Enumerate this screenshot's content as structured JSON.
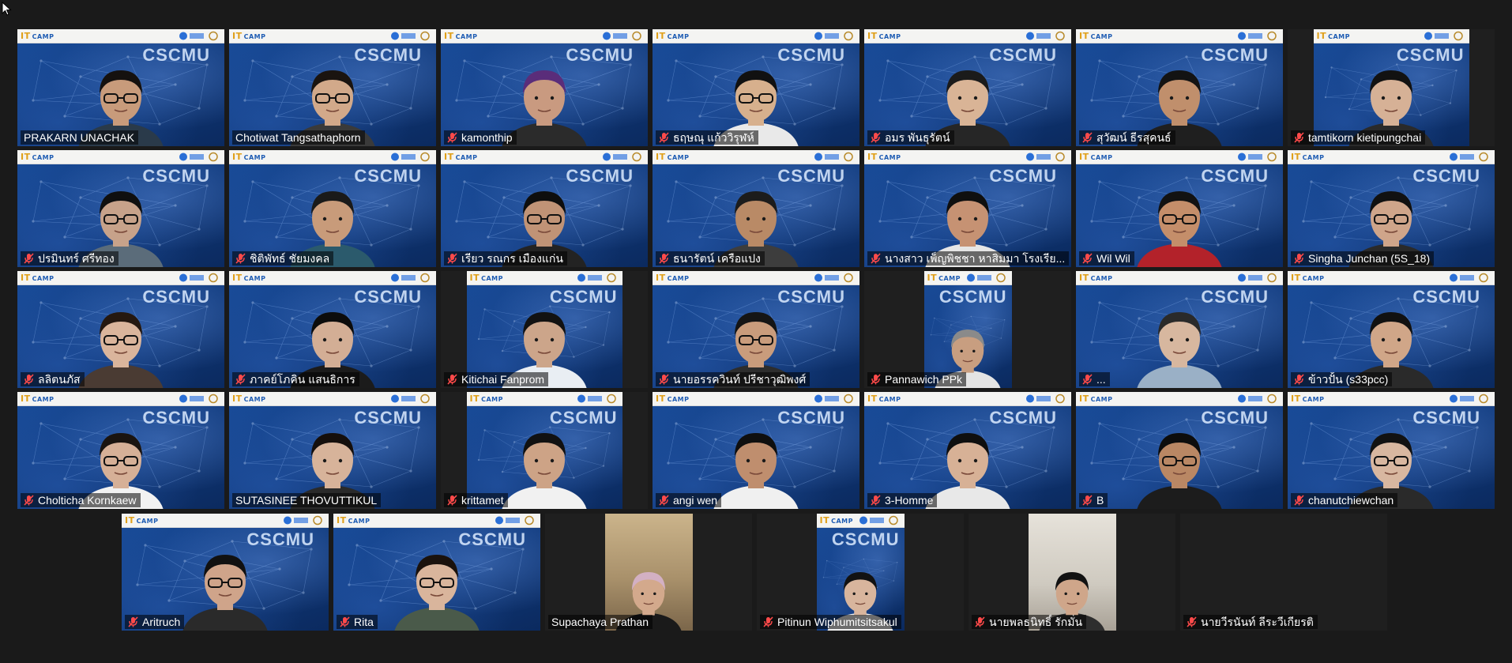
{
  "meeting": {
    "participants": [
      {
        "name": "PRAKARN UNACHAK",
        "muted": false,
        "style": "full",
        "shirt": "#2a3a4a",
        "skin": "#c89b7b",
        "hair": "#15110f",
        "glasses": true
      },
      {
        "name": "Chotiwat Tangsathaphorn",
        "muted": false,
        "style": "full",
        "shirt": "#3a3a3a",
        "skin": "#d2a98a",
        "hair": "#1a1410",
        "glasses": true
      },
      {
        "name": "kamonthip",
        "muted": true,
        "style": "full",
        "shirt": "#2b2b2b",
        "skin": "#c99a80",
        "hair": "#5a2d7a",
        "glasses": false
      },
      {
        "name": "ธฤษณุ แก้ววิรุฬห์",
        "muted": true,
        "style": "full",
        "shirt": "#e9e9e9",
        "skin": "#d7b08d",
        "hair": "#111111",
        "glasses": true
      },
      {
        "name": "อมร พันธุรัตน์",
        "muted": true,
        "style": "full",
        "shirt": "#262626",
        "skin": "#d9b496",
        "hair": "#1b1b1b",
        "glasses": false
      },
      {
        "name": "สุวัฒน์ ธีรสุคนธ์",
        "muted": true,
        "style": "full",
        "shirt": "#1f1f1f",
        "skin": "#c08f6c",
        "hair": "#131313",
        "glasses": false
      },
      {
        "name": "tamtikorn kietipungchai",
        "muted": true,
        "style": "narrow",
        "shirt": "#2a2a2a",
        "skin": "#d6b196",
        "hair": "#121212",
        "glasses": false
      },
      {
        "name": "ปรมินทร์ ศรีทอง",
        "muted": true,
        "style": "full",
        "shirt": "#5b6c7a",
        "skin": "#c7a28a",
        "hair": "#0f0f0f",
        "glasses": true
      },
      {
        "name": "ชิติพัทธ์ ชัยมงคล",
        "muted": true,
        "style": "full",
        "shirt": "#2b5a6c",
        "skin": "#c89b7a",
        "hair": "#1a1a1a",
        "glasses": false
      },
      {
        "name": "เรียว รณกร เมืองแก่น",
        "muted": true,
        "style": "full",
        "shirt": "#232323",
        "skin": "#c09376",
        "hair": "#0e0e0e",
        "glasses": true
      },
      {
        "name": "ธนารัตน์ เครือแปง",
        "muted": true,
        "style": "full",
        "shirt": "#3d3d3d",
        "skin": "#b98a66",
        "hair": "#1c1c1c",
        "glasses": false
      },
      {
        "name": "นางสาว เพ็ญพิชชา หาสิมมา โรงเรีย...",
        "muted": true,
        "style": "full",
        "shirt": "#e6e6e6",
        "skin": "#c69273",
        "hair": "#0f0f0f",
        "glasses": false
      },
      {
        "name": "Wil Wil",
        "muted": true,
        "style": "full",
        "shirt": "#b3222a",
        "skin": "#c48e6a",
        "hair": "#121212",
        "glasses": true
      },
      {
        "name": "Singha Junchan (5S_18)",
        "muted": true,
        "style": "full",
        "shirt": "#2a2a2a",
        "skin": "#cfa58a",
        "hair": "#111111",
        "glasses": true
      },
      {
        "name": "ลลิตนภัส",
        "muted": true,
        "style": "full",
        "shirt": "#4a3b33",
        "skin": "#dab59c",
        "hair": "#251810",
        "glasses": true
      },
      {
        "name": "ภาคย์โภคิน แสนธิการ",
        "muted": true,
        "style": "full",
        "shirt": "#1b1b1b",
        "skin": "#d3ae95",
        "hair": "#0c0c0c",
        "glasses": false
      },
      {
        "name": "Kitichai Fanprom",
        "muted": true,
        "style": "narrow",
        "shirt": "#e9eef3",
        "skin": "#cca58a",
        "hair": "#121212",
        "glasses": false
      },
      {
        "name": "นายอรรควินท์ ปรีชาวุฒิพงศ์",
        "muted": true,
        "style": "full",
        "shirt": "#2d2d2d",
        "skin": "#c99c7c",
        "hair": "#151515",
        "glasses": true
      },
      {
        "name": "Pannawich PPk",
        "muted": true,
        "style": "narrow-small",
        "shirt": "#e4e4e4",
        "skin": "#c89e80",
        "hair": "#8a8a8a",
        "glasses": false
      },
      {
        "name": "...",
        "muted": true,
        "style": "full",
        "shirt": "#9ab0c6",
        "skin": "#d7b79f",
        "hair": "#2a2a2a",
        "glasses": false
      },
      {
        "name": "ข้าวปั้น (s33pcc)",
        "muted": true,
        "style": "full",
        "shirt": "#2a2a2a",
        "skin": "#d0a688",
        "hair": "#111111",
        "glasses": false
      },
      {
        "name": "Cholticha Kornkaew",
        "muted": true,
        "style": "full",
        "shirt": "#f2f2f2",
        "skin": "#d6b097",
        "hair": "#1a1410",
        "glasses": true
      },
      {
        "name": "SUTASINEE THOVUTTIKUL",
        "muted": false,
        "style": "full",
        "shirt": "#2a2a2a",
        "skin": "#d7b39a",
        "hair": "#150f0c",
        "glasses": false
      },
      {
        "name": "krittamet",
        "muted": true,
        "style": "narrow",
        "shirt": "#f1f1f1",
        "skin": "#cda386",
        "hair": "#111111",
        "glasses": false
      },
      {
        "name": "angi wen",
        "muted": true,
        "style": "full",
        "shirt": "#f0f0f0",
        "skin": "#bf8e6e",
        "hair": "#0f0f0f",
        "glasses": false
      },
      {
        "name": "3-Homme",
        "muted": true,
        "style": "full",
        "shirt": "#e8e8e8",
        "skin": "#d7b196",
        "hair": "#0f0f0f",
        "glasses": false
      },
      {
        "name": "B",
        "muted": true,
        "style": "full",
        "shirt": "#1c1c1c",
        "skin": "#b98764",
        "hair": "#0d0d0d",
        "glasses": true
      },
      {
        "name": "chanutchiewchan",
        "muted": true,
        "style": "full",
        "shirt": "#2a2a2a",
        "skin": "#d8b7a0",
        "hair": "#121212",
        "glasses": true
      },
      {
        "name": "Aritruch",
        "muted": true,
        "style": "full",
        "shirt": "#2a2a2a",
        "skin": "#cfa48a",
        "hair": "#111111",
        "glasses": true
      },
      {
        "name": "Rita",
        "muted": true,
        "style": "full",
        "shirt": "#4a5a4a",
        "skin": "#d9b59c",
        "hair": "#1a120d",
        "glasses": true
      },
      {
        "name": "Supachaya Prathan",
        "muted": false,
        "style": "room",
        "shirt": "#1a1a1a",
        "skin": "#d3a98c",
        "hair": "#d3b0c3",
        "glasses": false
      },
      {
        "name": "Pitinun Wiphumitsitsakul",
        "muted": true,
        "style": "narrow-small",
        "shirt": "#f0f0f0",
        "skin": "#d8b59d",
        "hair": "#121212",
        "glasses": false
      },
      {
        "name": "นายพลธนิทธิ์ รักมั่น",
        "muted": true,
        "style": "room2",
        "shirt": "#2e2e2e",
        "skin": "#cfa68a",
        "hair": "#121212",
        "glasses": false
      },
      {
        "name": "นายวีรนันท์ ลีระวีเกียรติ",
        "muted": true,
        "style": "empty",
        "shirt": "#000000",
        "skin": "#000000",
        "hair": "#000000",
        "glasses": false
      }
    ]
  },
  "brand": {
    "logo_text": "IT",
    "logo_sub": "CAMP",
    "watermark": "CSCMU"
  }
}
